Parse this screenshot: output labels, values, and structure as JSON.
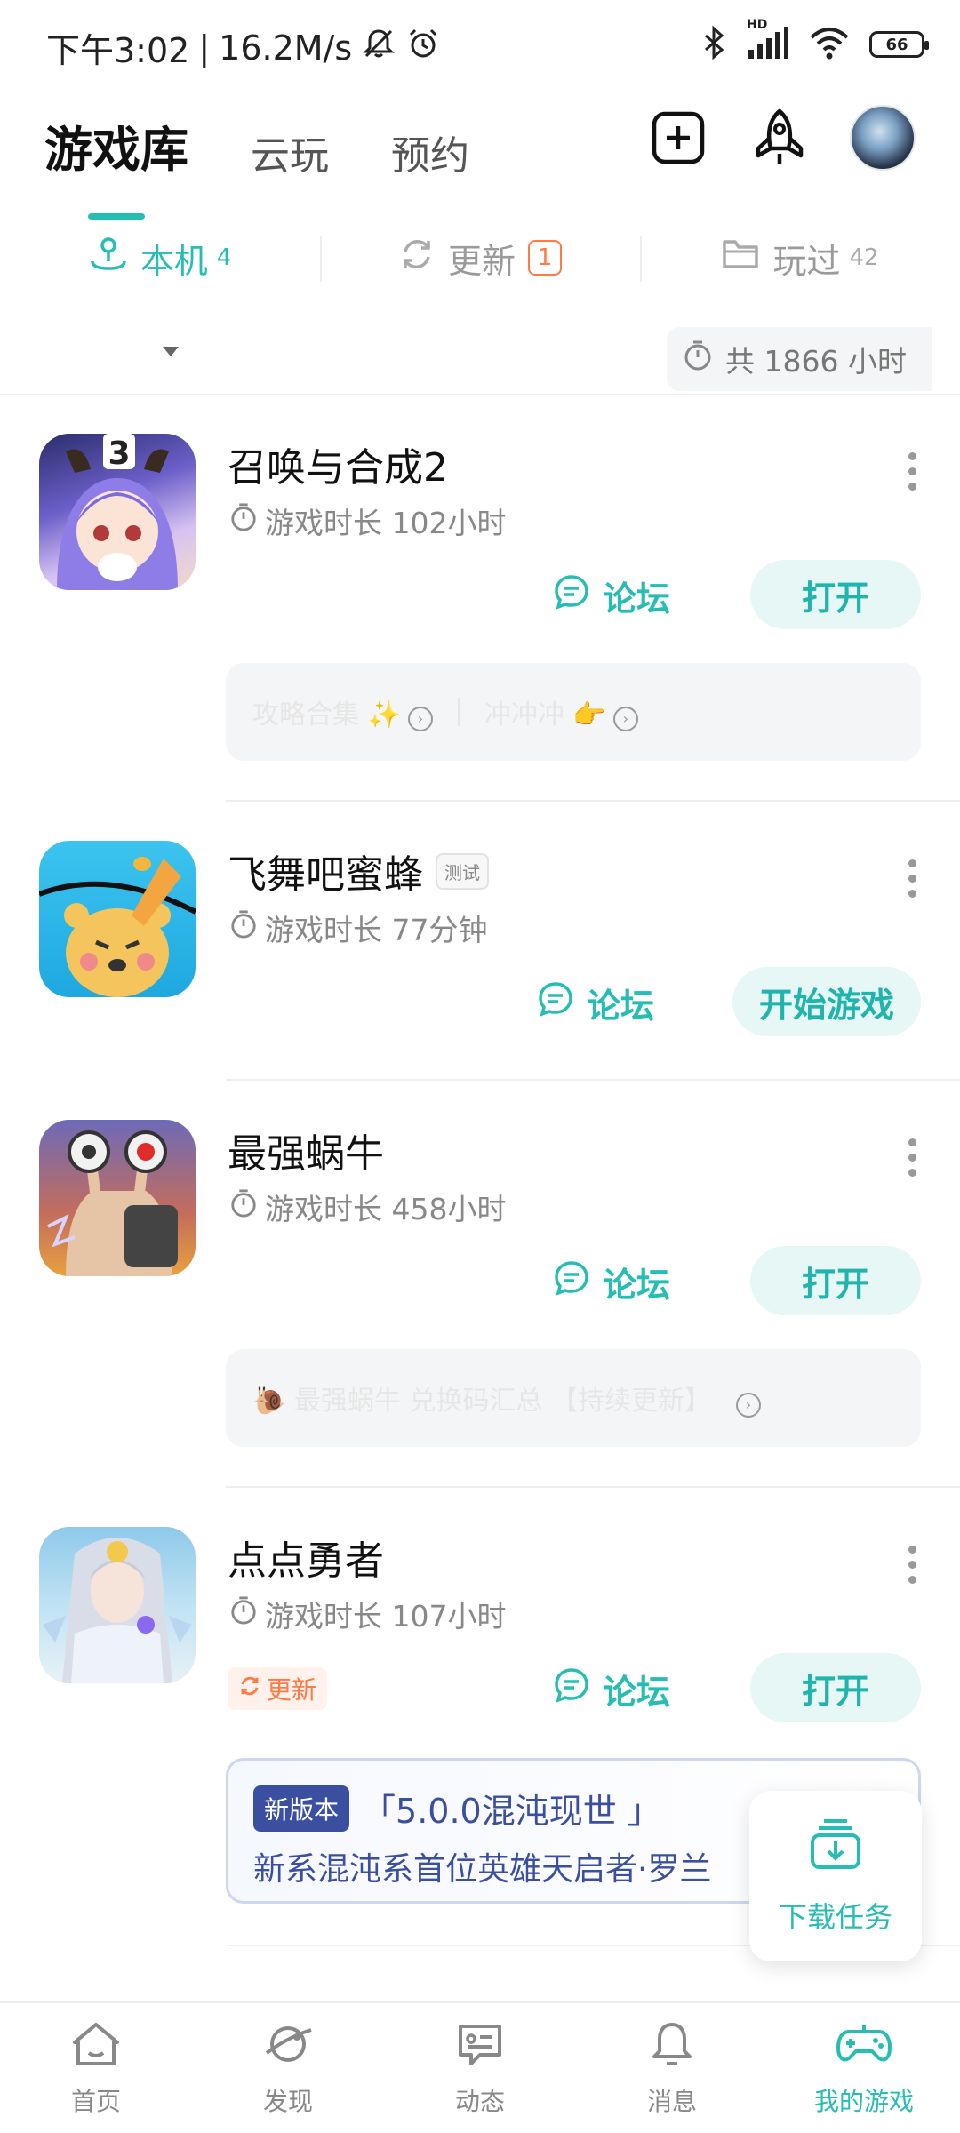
{
  "status_bar": {
    "time": "下午3:02",
    "speed": "16.2M/s",
    "hd": "HD",
    "battery": "66"
  },
  "header": {
    "tabs": [
      {
        "label": "游戏库",
        "active": true
      },
      {
        "label": "云玩",
        "active": false
      },
      {
        "label": "预约",
        "active": false
      }
    ]
  },
  "sub_tabs": [
    {
      "label": "本机",
      "count": "4",
      "active": true
    },
    {
      "label": "更新",
      "badge": "1",
      "active": false
    },
    {
      "label": "玩过",
      "count": "42",
      "active": false
    }
  ],
  "summary": {
    "total_time": "共 1866 小时"
  },
  "games": [
    {
      "title": "召唤与合成2",
      "playtime": "游戏时长 102小时",
      "forum_label": "论坛",
      "action_label": "打开",
      "icon_text": "3",
      "notes": [
        "攻略合集 ✨",
        "冲冲冲 👉"
      ]
    },
    {
      "title": "飞舞吧蜜蜂",
      "badge": "测试",
      "playtime": "游戏时长 77分钟",
      "forum_label": "论坛",
      "action_label": "开始游戏"
    },
    {
      "title": "最强蜗牛",
      "playtime": "游戏时长 458小时",
      "forum_label": "论坛",
      "action_label": "打开",
      "notes": [
        "🐌 最强蜗牛 兑换码汇总 【持续更新】"
      ]
    },
    {
      "title": "点点勇者",
      "playtime": "游戏时长 107小时",
      "forum_label": "论坛",
      "action_label": "打开",
      "update_tag": "更新",
      "news": {
        "badge": "新版本",
        "title": "「5.0.0混沌现世 」",
        "text": "新系混沌系首位英雄天启者·罗兰"
      }
    }
  ],
  "download_task": {
    "label": "下载任务"
  },
  "bottom_nav": [
    {
      "label": "首页",
      "icon": "home-icon"
    },
    {
      "label": "发现",
      "icon": "discover-icon"
    },
    {
      "label": "动态",
      "icon": "feed-icon"
    },
    {
      "label": "消息",
      "icon": "bell-icon"
    },
    {
      "label": "我的游戏",
      "icon": "gamepad-icon",
      "active": true
    }
  ],
  "colors": {
    "accent": "#26bdb5",
    "update": "#ff7a45",
    "news": "#3b4fa0"
  }
}
